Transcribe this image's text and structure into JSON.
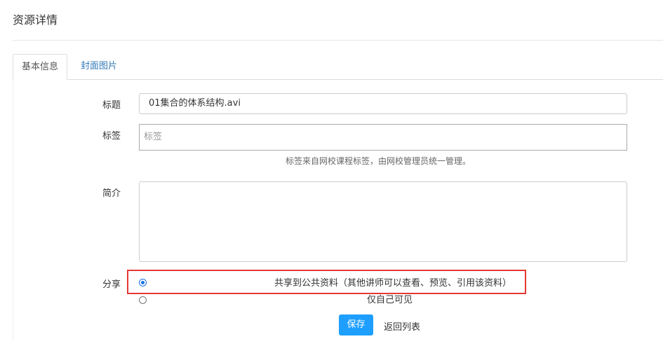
{
  "page": {
    "title": "资源详情"
  },
  "tabs": [
    {
      "label": "基本信息",
      "active": true
    },
    {
      "label": "封面图片",
      "active": false
    }
  ],
  "form": {
    "title_label": "标题",
    "title_value": "01集合的体系结构.avi",
    "tag_label": "标签",
    "tag_placeholder": "标签",
    "tag_help": "标签来自网校课程标签，由网校管理员统一管理。",
    "intro_label": "简介",
    "intro_value": "",
    "share_label": "分享",
    "share_options": [
      {
        "label": "共享到公共资料（其他讲师可以查看、预览、引用该资料）",
        "checked": true
      },
      {
        "label": "仅自己可见",
        "checked": false
      }
    ]
  },
  "actions": {
    "save_label": "保存",
    "back_label": "返回列表"
  },
  "colors": {
    "primary_button": "#1e9fff",
    "link": "#337ab7",
    "highlight_border": "#e53935",
    "radio_checked": "#1a73e8"
  }
}
